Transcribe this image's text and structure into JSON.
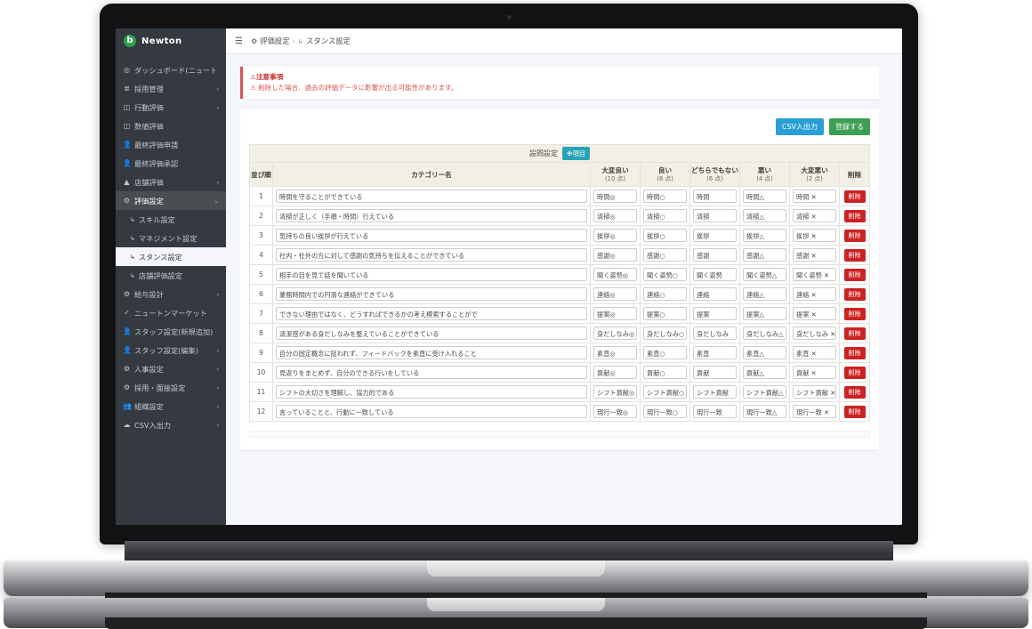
{
  "brand": {
    "name": "Newton",
    "logo_glyph": "b",
    "logo_color": "#2f9e52"
  },
  "sidebar": {
    "items": [
      {
        "label": "ダッシュボード(ニュートン)",
        "icon": "dashboard-icon",
        "caret": ""
      },
      {
        "label": "採用管理",
        "icon": "list-icon",
        "caret": "‹"
      },
      {
        "label": "行動評価",
        "icon": "id-card-icon",
        "caret": "‹"
      },
      {
        "label": "数値評価",
        "icon": "id-card-icon",
        "caret": ""
      },
      {
        "label": "最終評価申請",
        "icon": "user-check-icon",
        "caret": ""
      },
      {
        "label": "最終評価承認",
        "icon": "user-check-icon",
        "caret": ""
      },
      {
        "label": "店舗評価",
        "icon": "store-icon",
        "caret": "‹"
      },
      {
        "label": "評価設定",
        "icon": "settings-users-icon",
        "caret": "⌄",
        "open": true
      }
    ],
    "sub_items": [
      {
        "label": "スキル設定",
        "active": false
      },
      {
        "label": "マネジメント設定",
        "active": false
      },
      {
        "label": "スタンス設定",
        "active": true
      },
      {
        "label": "店舗評価設定",
        "active": false
      }
    ],
    "items_after": [
      {
        "label": "給与設計",
        "icon": "gear-icon",
        "caret": "‹"
      },
      {
        "label": "ニュートンマーケット",
        "icon": "check-circle-icon",
        "caret": ""
      },
      {
        "label": "スタッフ設定(新規追加)",
        "icon": "user-plus-icon",
        "caret": ""
      },
      {
        "label": "スタッフ設定(編集)",
        "icon": "user-edit-icon",
        "caret": "‹"
      },
      {
        "label": "人事設定",
        "icon": "gear-icon",
        "caret": "‹"
      },
      {
        "label": "採用・面接設定",
        "icon": "gear-icon",
        "caret": "‹"
      },
      {
        "label": "組織設定",
        "icon": "users-icon",
        "caret": "‹"
      },
      {
        "label": "CSV入出力",
        "icon": "cloud-icon",
        "caret": "‹"
      }
    ]
  },
  "topbar": {
    "menu_icon": "hamburger-icon",
    "breadcrumb_icon": "settings-users-icon",
    "breadcrumb_parent": "評価設定",
    "breadcrumb_sep": "›",
    "breadcrumb_arrow": "↳",
    "breadcrumb_current": "スタンス設定"
  },
  "alert": {
    "title": "注意事項",
    "icon": "warning-icon",
    "message": "削除した場合、過去の評価データに影響が出る可能性があります。"
  },
  "toolbar": {
    "csv_label": "CSV入出力",
    "register_label": "登録する",
    "csv_color": "#2a9fd6",
    "register_color": "#3d9e54"
  },
  "table": {
    "band_label": "設問設定",
    "add_item_label": "項目",
    "add_item_icon": "plus-circle-icon",
    "add_item_color": "#29a3b8",
    "delete_button_label": "削除",
    "delete_color": "#cc2222",
    "headers": [
      {
        "label": "並び順",
        "points": ""
      },
      {
        "label": "カテゴリー名",
        "points": ""
      },
      {
        "label": "大変良い",
        "points": "(10 点)"
      },
      {
        "label": "良い",
        "points": "(8 点)"
      },
      {
        "label": "どちらでもない",
        "points": "(6 点)"
      },
      {
        "label": "悪い",
        "points": "(4 点)"
      },
      {
        "label": "大変悪い",
        "points": "(2 点)"
      },
      {
        "label": "削除",
        "points": ""
      }
    ],
    "rows": [
      {
        "ord": "1",
        "name": "時間を守ることができている",
        "s10": "時間◎",
        "s8": "時間○",
        "s6": "時間",
        "s4": "時間△",
        "s2": "時間 ✕"
      },
      {
        "ord": "2",
        "name": "清掃が正しく（手順・時間）行えている",
        "s10": "清掃◎",
        "s8": "清掃○",
        "s6": "清掃",
        "s4": "清掃△",
        "s2": "清掃 ✕"
      },
      {
        "ord": "3",
        "name": "気持ちの良い挨拶が行えている",
        "s10": "挨拶◎",
        "s8": "挨拶○",
        "s6": "挨拶",
        "s4": "挨拶△",
        "s2": "挨拶 ✕"
      },
      {
        "ord": "4",
        "name": "社内・社外の方に対して感謝の気持ちを伝えることができている",
        "s10": "感謝◎",
        "s8": "感謝○",
        "s6": "感謝",
        "s4": "感謝△",
        "s2": "感謝 ✕"
      },
      {
        "ord": "5",
        "name": "相手の目を見て話を聞いている",
        "s10": "聞く姿勢◎",
        "s8": "聞く姿勢○",
        "s6": "聞く姿勢",
        "s4": "聞く姿勢△",
        "s2": "聞く姿勢 ✕"
      },
      {
        "ord": "6",
        "name": "業務時間内での円滑な連絡ができている",
        "s10": "連絡◎",
        "s8": "連絡○",
        "s6": "連絡",
        "s4": "連絡△",
        "s2": "連絡 ✕"
      },
      {
        "ord": "7",
        "name": "できない理由ではなく、どうすればできるかの考え模索することがで",
        "s10": "提案◎",
        "s8": "提案○",
        "s6": "提案",
        "s4": "提案△",
        "s2": "提案 ✕"
      },
      {
        "ord": "8",
        "name": "清潔感がある身だしなみを整えていることができている",
        "s10": "身だしなみ◎",
        "s8": "身だしなみ○",
        "s6": "身だしなみ",
        "s4": "身だしなみ△",
        "s2": "身だしなみ ✕"
      },
      {
        "ord": "9",
        "name": "自分の固定概念に捉われず、フィードバックを素直に受け入れること",
        "s10": "素直◎",
        "s8": "素直○",
        "s6": "素直",
        "s4": "素直△",
        "s2": "素直 ✕"
      },
      {
        "ord": "10",
        "name": "見返りをまとめず、自分のできる行いをしている",
        "s10": "貢献◎",
        "s8": "貢献○",
        "s6": "貢献",
        "s4": "貢献△",
        "s2": "貢献 ✕"
      },
      {
        "ord": "11",
        "name": "シフトの大切さを理解し、協力的である",
        "s10": "シフト貢献◎",
        "s8": "シフト貢献○",
        "s6": "シフト貢献",
        "s4": "シフト貢献△",
        "s2": "シフト貢献 ✕"
      },
      {
        "ord": "12",
        "name": "言っていることと、行動に一致している",
        "s10": "現行一致◎",
        "s8": "現行一致○",
        "s6": "現行一致",
        "s4": "現行一致△",
        "s2": "現行一致 ✕"
      }
    ]
  }
}
